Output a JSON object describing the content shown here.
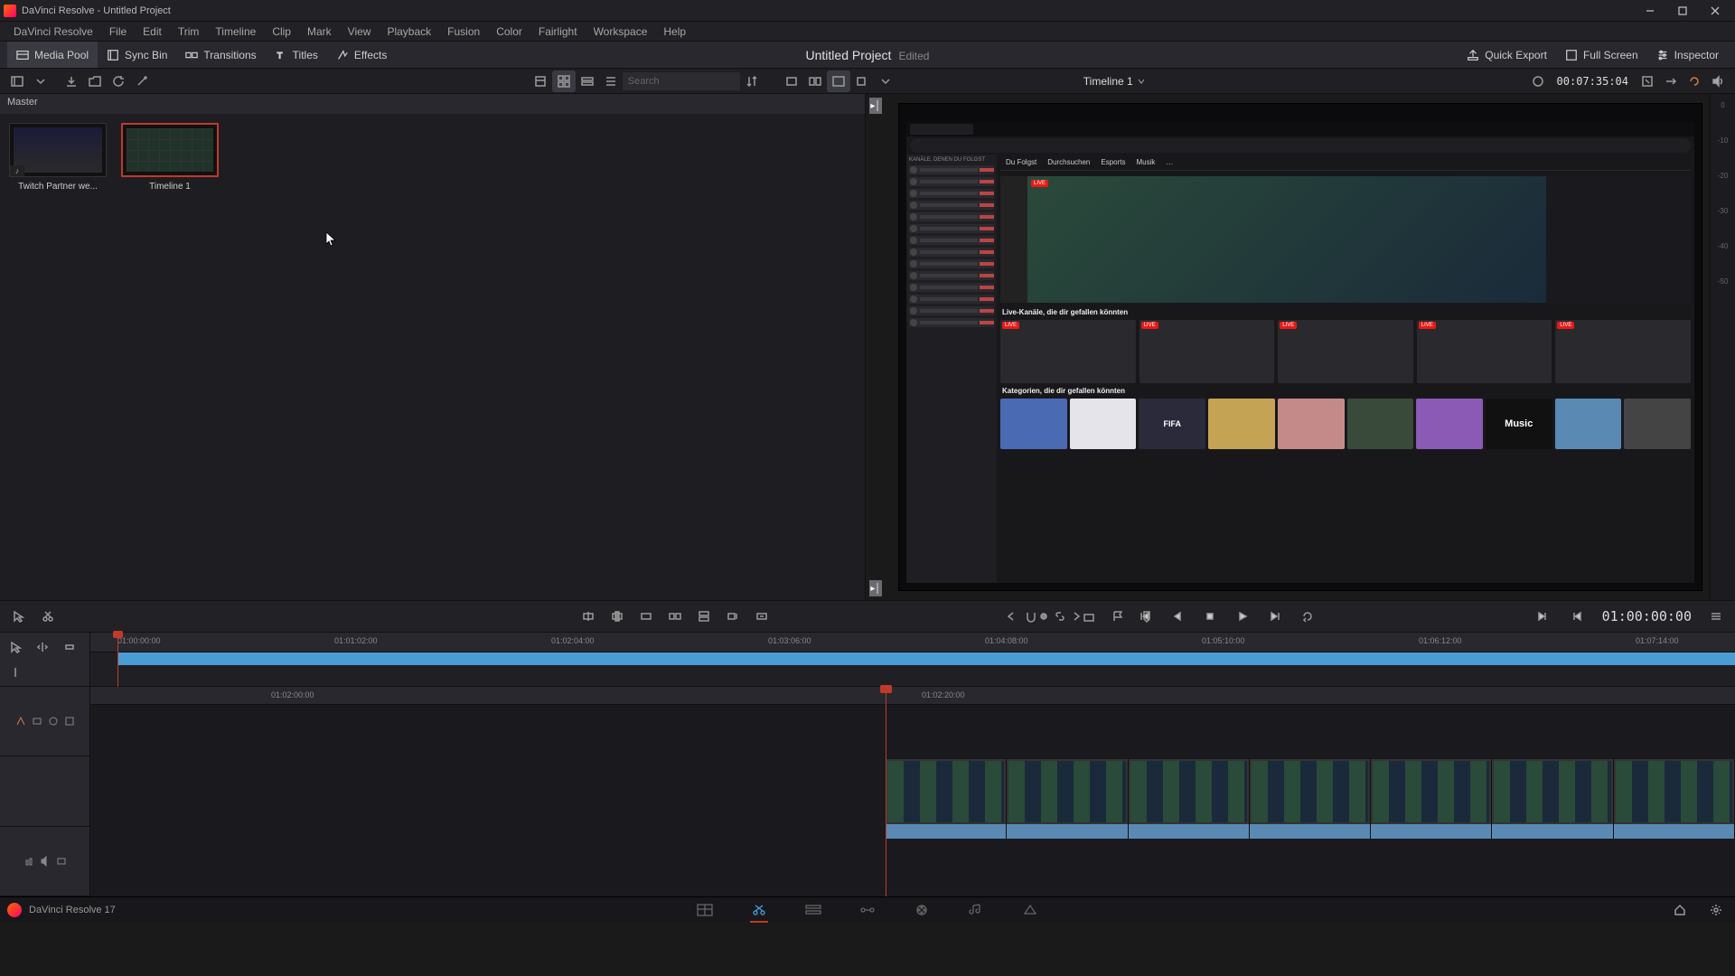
{
  "window": {
    "title": "DaVinci Resolve - Untitled Project"
  },
  "menu": [
    "DaVinci Resolve",
    "File",
    "Edit",
    "Trim",
    "Timeline",
    "Clip",
    "Mark",
    "View",
    "Playback",
    "Fusion",
    "Color",
    "Fairlight",
    "Workspace",
    "Help"
  ],
  "toolbar": {
    "media_pool": "Media Pool",
    "sync_bin": "Sync Bin",
    "transitions": "Transitions",
    "titles": "Titles",
    "effects": "Effects",
    "project": "Untitled Project",
    "edited": "Edited",
    "quick_export": "Quick Export",
    "full_screen": "Full Screen",
    "inspector": "Inspector"
  },
  "subbar": {
    "search_placeholder": "Search",
    "timeline_label": "Timeline 1",
    "source_tc": "00:07:35:04"
  },
  "pool": {
    "header": "Master",
    "clips": [
      {
        "label": "Twitch Partner we..."
      },
      {
        "label": "Timeline 1"
      }
    ]
  },
  "preview": {
    "nav": [
      "Du Folgst",
      "Durchsuchen",
      "Esports",
      "Musik",
      "…"
    ],
    "side_header": "KANÄLE, DENEN DU FOLGST",
    "section1": "Live-Kanäle, die dir gefallen könnten",
    "section2": "Kategorien, die dir gefallen könnten",
    "live": "LIVE",
    "cats": [
      "",
      "",
      "FIFA",
      "",
      "",
      "",
      "",
      "Music",
      "",
      ""
    ]
  },
  "meter_ticks": [
    "0",
    "-10",
    "-20",
    "-30",
    "-40",
    "-50"
  ],
  "edit_toolbar": {
    "record_tc": "01:00:00:00"
  },
  "timeline": {
    "upper_ticks": [
      "01:00:00:00",
      "01:01:02:00",
      "01:02:04:00",
      "01:03:06:00",
      "01:04:08:00",
      "01:05:10:00",
      "01:06:12:00",
      "01:07:14:00"
    ],
    "lower_ticks": [
      "01:02:00:00",
      "01:02:20:00"
    ]
  },
  "pagebar": {
    "app": "DaVinci Resolve 17"
  }
}
